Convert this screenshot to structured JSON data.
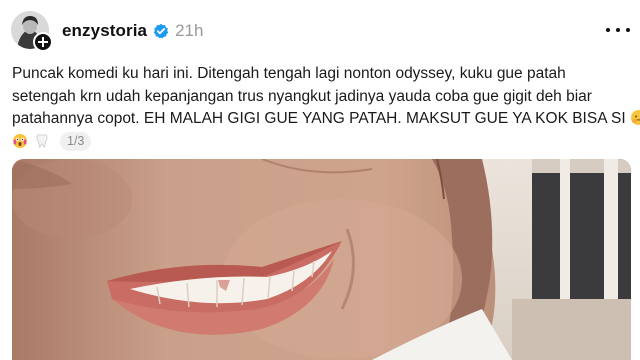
{
  "post": {
    "author": {
      "username": "enzystoria",
      "verified": true,
      "avatar_icon": "avatar-photo",
      "follow_icon": "plus-icon"
    },
    "timestamp": "21h",
    "more_icon": "more-horizontal-icon",
    "text_lines": [
      "Puncak komedi ku hari ini. Ditengah tengah lagi nonton odyssey, kuku gue patah",
      "setengah krn udah kepanjangan trus nyangkut jadinya yauda coba gue gigit deh biar",
      "patahannya copot. EH MALAH GIGI GUE YANG PATAH. MAKSUT GUE YA KOK BISA SI"
    ],
    "text_end_emoji": "face-holding-back-tears-emoji",
    "reactions": {
      "icons": [
        "shocked-face-emoji",
        "tooth-emoji"
      ],
      "counter": "1/3"
    },
    "media": {
      "type": "photo",
      "description_icon": "smiling-face-closeup"
    }
  },
  "colors": {
    "background": "#ffffff",
    "text": "#1a1a1a",
    "muted": "#9a9a9a",
    "verified": "#1d9bf0",
    "pill_bg": "#f0f0f0"
  }
}
